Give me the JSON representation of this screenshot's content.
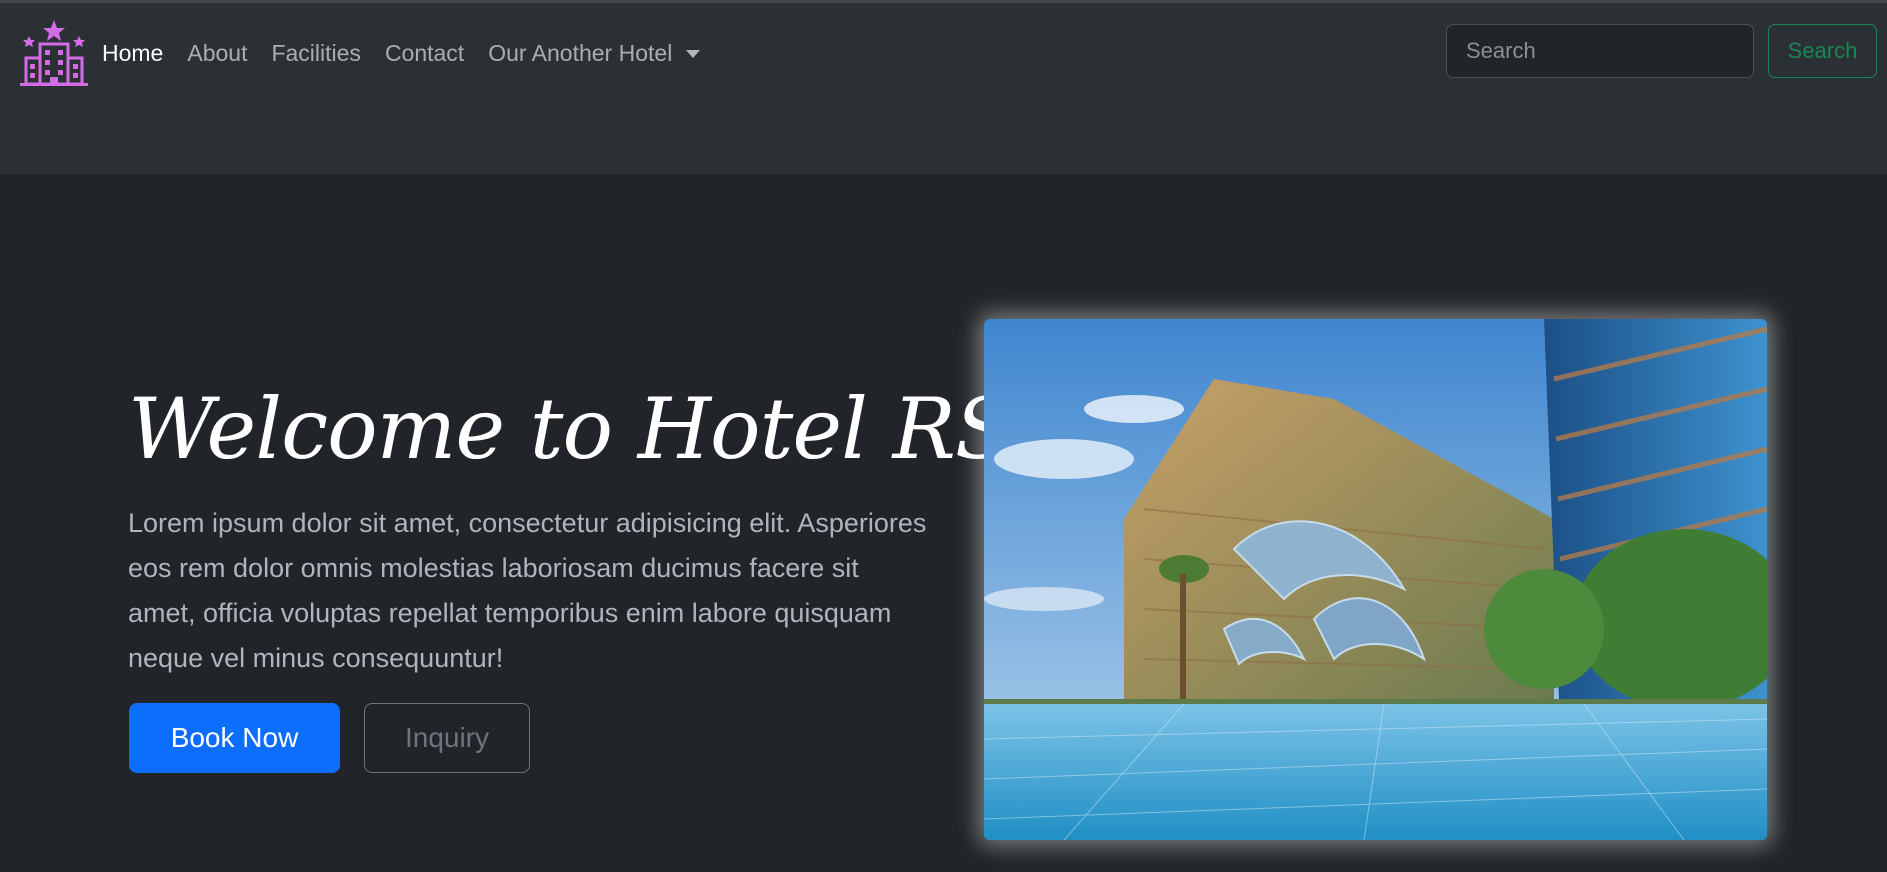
{
  "navbar": {
    "brand_icon": "hotel-logo-icon",
    "links": [
      {
        "label": "Home",
        "active": true
      },
      {
        "label": "About",
        "active": false
      },
      {
        "label": "Facilities",
        "active": false
      },
      {
        "label": "Contact",
        "active": false
      }
    ],
    "dropdown": {
      "label": "Our Another Hotel"
    },
    "search": {
      "placeholder": "Search",
      "button_label": "Search"
    }
  },
  "hero": {
    "title": "Welcome to Hotel RS",
    "description": "Lorem ipsum dolor sit amet, consectetur adipisicing elit. Asperiores eos rem dolor omnis molestias laboriosam ducimus facere sit amet, officia voluptas repellat temporibus enim labore quisquam neque vel minus consequuntur!",
    "book_button": "Book Now",
    "inquiry_button": "Inquiry"
  },
  "colors": {
    "background": "#212529",
    "navbar": "#2b3035",
    "primary": "#0d6efd",
    "success": "#198754",
    "logo": "#d36be6"
  }
}
